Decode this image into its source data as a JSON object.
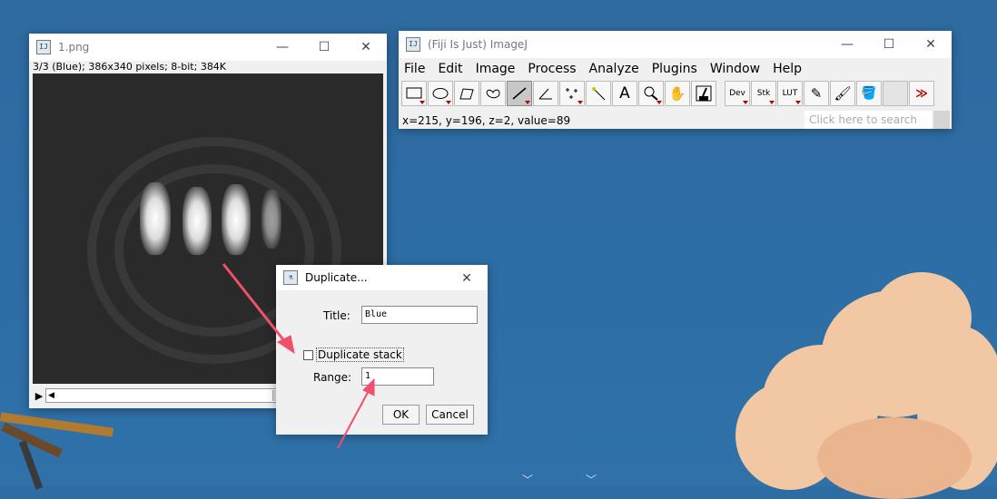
{
  "image_window": {
    "title": "1.png",
    "info": "3/3 (Blue); 386x340 pixels; 8-bit; 384K"
  },
  "imagej": {
    "title": "(Fiji Is Just) ImageJ",
    "menu": [
      "File",
      "Edit",
      "Image",
      "Process",
      "Analyze",
      "Plugins",
      "Window",
      "Help"
    ],
    "tools": {
      "dev": "Dev",
      "stk": "Stk",
      "lut": "LUT",
      "more": "≫"
    },
    "status": "x=215, y=196, z=2, value=89",
    "search_placeholder": "Click here to search"
  },
  "dialog": {
    "title": "Duplicate...",
    "title_label": "Title:",
    "title_value": "Blue",
    "duplicate_stack_label": "Duplicate stack",
    "duplicate_stack_checked": false,
    "range_label": "Range:",
    "range_value": "1",
    "ok_label": "OK",
    "cancel_label": "Cancel"
  },
  "colors": {
    "desktop": "#2e6da4",
    "annotation_arrow": "#f0506a"
  }
}
